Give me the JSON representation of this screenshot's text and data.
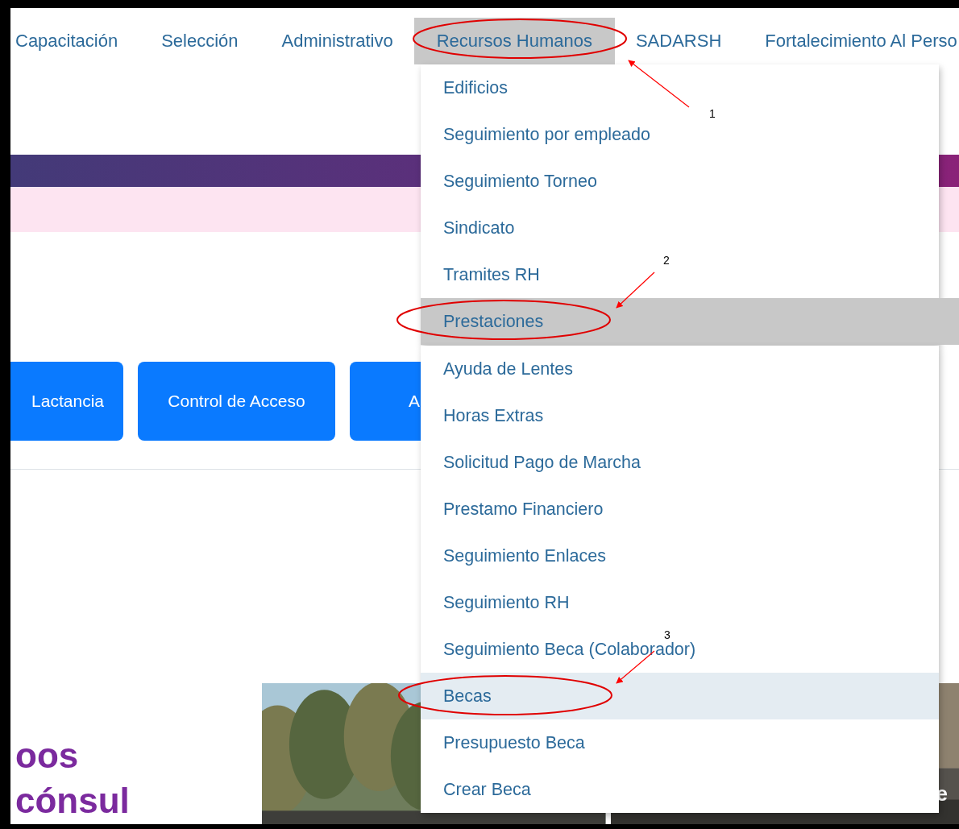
{
  "nav": {
    "items": [
      {
        "label": "Capacitación",
        "selected": false
      },
      {
        "label": "Selección",
        "selected": false
      },
      {
        "label": "Administrativo",
        "selected": false
      },
      {
        "label": "Recursos Humanos",
        "selected": true
      },
      {
        "label": "SADARSH",
        "selected": false
      },
      {
        "label": "Fortalecimiento Al Perso",
        "selected": false
      }
    ]
  },
  "dropdown": {
    "items": [
      {
        "label": "Edificios",
        "selected": false
      },
      {
        "label": "Seguimiento por empleado",
        "selected": false
      },
      {
        "label": "Seguimiento Torneo",
        "selected": false
      },
      {
        "label": "Sindicato",
        "selected": false
      },
      {
        "label": "Tramites RH",
        "selected": false
      },
      {
        "label": "Prestaciones",
        "expanded": true,
        "children": [
          {
            "label": "Ayuda de Lentes",
            "selected": false
          },
          {
            "label": "Horas Extras",
            "selected": false
          },
          {
            "label": "Solicitud Pago de Marcha",
            "selected": false
          },
          {
            "label": "Prestamo Financiero",
            "selected": false
          },
          {
            "label": "Seguimiento Enlaces",
            "selected": false
          },
          {
            "label": "Seguimiento RH",
            "selected": false
          },
          {
            "label": "Seguimiento Beca (Colaborador)",
            "selected": false
          },
          {
            "label": "Becas",
            "selected": true
          },
          {
            "label": "Presupuesto Beca",
            "selected": false
          },
          {
            "label": "Crear Beca",
            "selected": false
          }
        ]
      }
    ]
  },
  "buttons": [
    "Lactancia",
    "Control de Acceso",
    "A"
  ],
  "headline": [
    "oos",
    "cónsul"
  ],
  "cards": [
    {
      "kind": "picture"
    },
    {
      "kind": "picture",
      "caption": "e"
    }
  ],
  "annotations": [
    {
      "number": "1"
    },
    {
      "number": "2"
    },
    {
      "number": "3"
    }
  ]
}
